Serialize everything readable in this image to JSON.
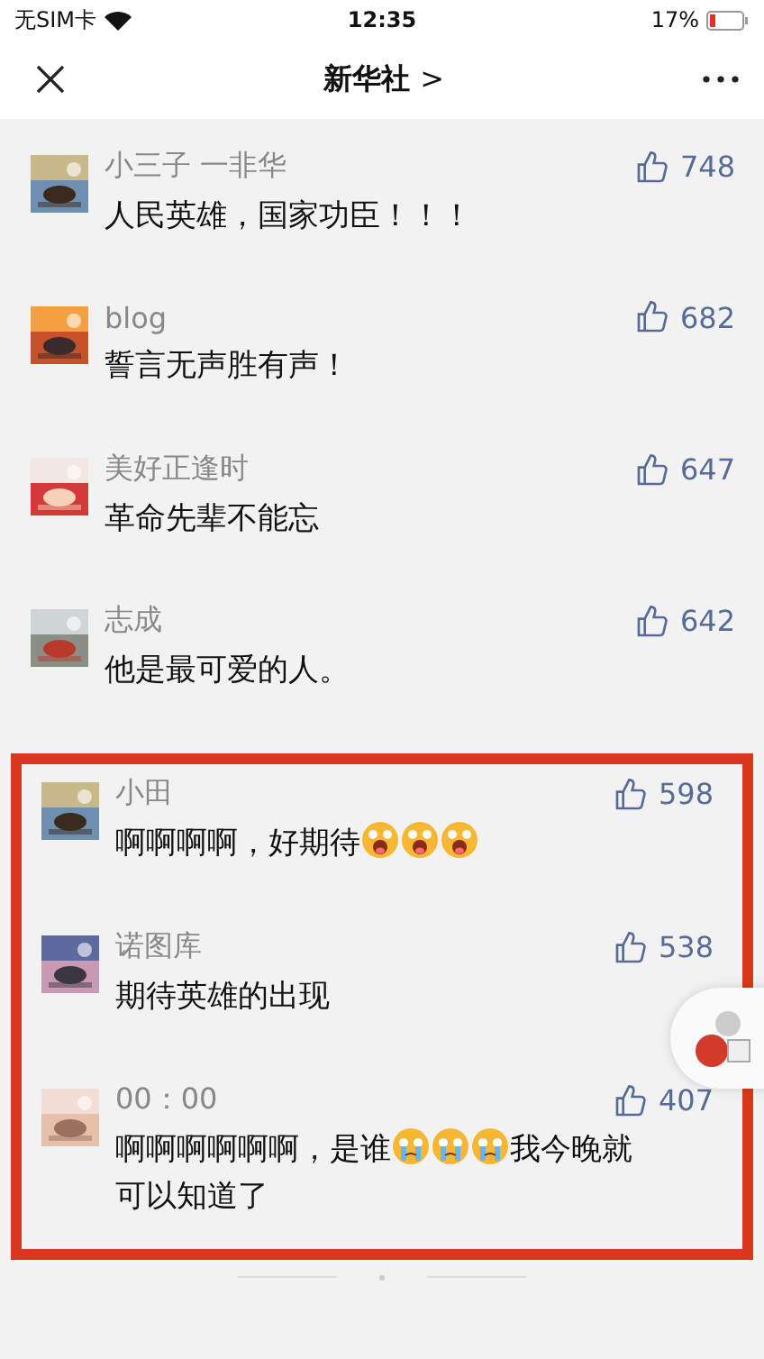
{
  "status_bar": {
    "carrier": "无SIM卡",
    "time": "12:35",
    "battery": "17%"
  },
  "nav": {
    "title": "新华社",
    "chevron": ">"
  },
  "comments": [
    {
      "name": "小三子 一非华",
      "likes": "748",
      "highlighted": false,
      "content": [
        {
          "kind": "text",
          "text": "人民英雄，国家功臣！！！"
        }
      ]
    },
    {
      "name": "blog",
      "likes": "682",
      "highlighted": false,
      "content": [
        {
          "kind": "text",
          "text": "誓言无声胜有声！"
        }
      ]
    },
    {
      "name": "美好正逢时",
      "likes": "647",
      "highlighted": false,
      "content": [
        {
          "kind": "text",
          "text": "革命先辈不能忘"
        }
      ]
    },
    {
      "name": "志成",
      "likes": "642",
      "highlighted": false,
      "content": [
        {
          "kind": "text",
          "text": "他是最可爱的人。"
        }
      ]
    },
    {
      "name": "小田",
      "likes": "598",
      "highlighted": true,
      "content": [
        {
          "kind": "text",
          "text": "啊啊啊啊，好期待"
        },
        {
          "kind": "excited"
        },
        {
          "kind": "excited"
        },
        {
          "kind": "excited"
        }
      ]
    },
    {
      "name": "诺图库",
      "likes": "538",
      "highlighted": true,
      "content": [
        {
          "kind": "text",
          "text": "期待英雄的出现"
        }
      ]
    },
    {
      "name": "00：00",
      "likes": "407",
      "highlighted": true,
      "content": [
        {
          "kind": "text",
          "text": "啊啊啊啊啊啊，是谁"
        },
        {
          "kind": "crying"
        },
        {
          "kind": "crying"
        },
        {
          "kind": "crying"
        },
        {
          "kind": "text",
          "text": "我今晚就"
        },
        {
          "kind": "line",
          "text": "可以知道了"
        }
      ]
    }
  ]
}
